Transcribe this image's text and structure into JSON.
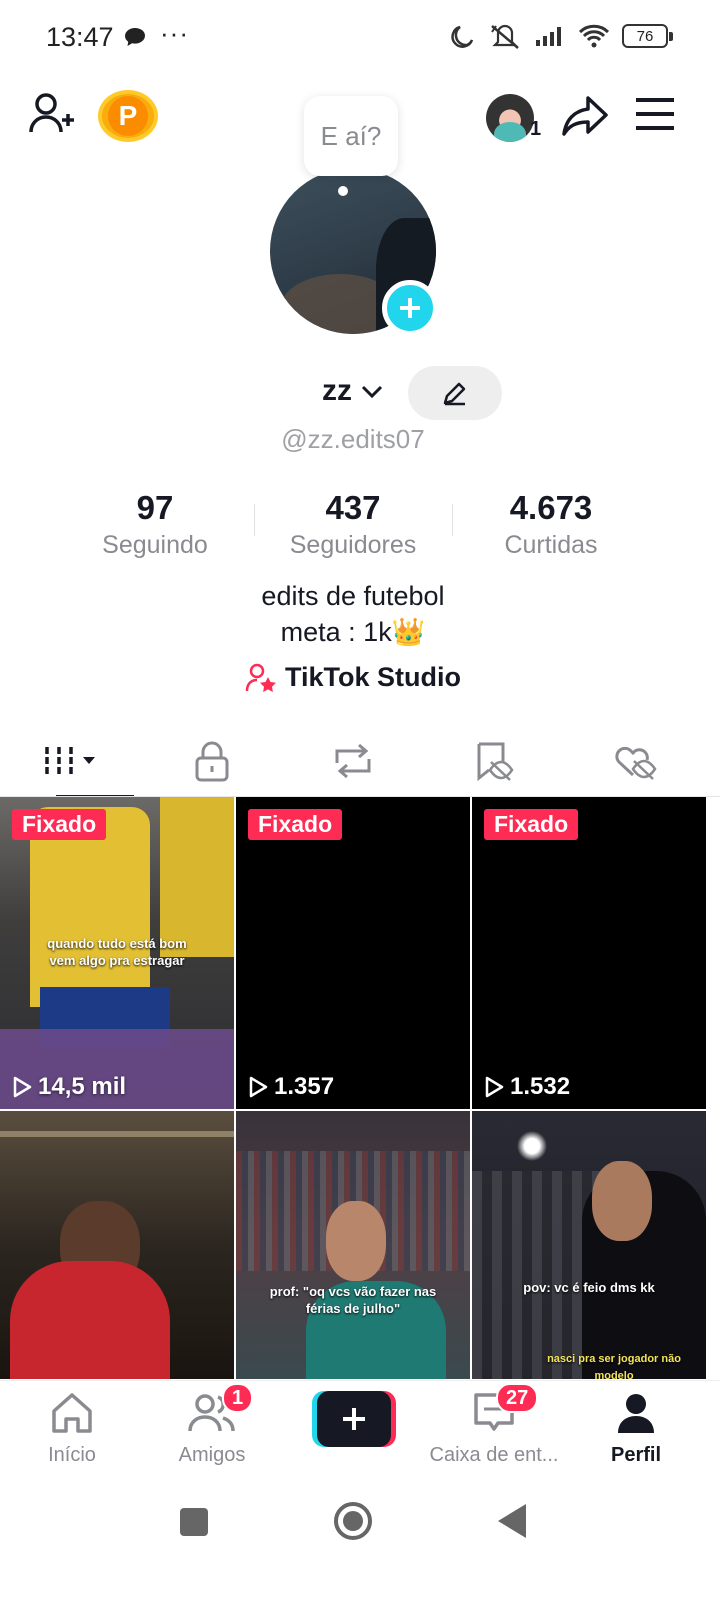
{
  "status_bar": {
    "time": "13:47",
    "more": "···",
    "battery": "76"
  },
  "header": {
    "avatar_count": "1",
    "coin_letter": "P"
  },
  "profile": {
    "bubble_text": "E aí?",
    "username": "zz",
    "handle": "@zz.edits07",
    "stats": [
      {
        "value": "97",
        "label": "Seguindo"
      },
      {
        "value": "437",
        "label": "Seguidores"
      },
      {
        "value": "4.673",
        "label": "Curtidas"
      }
    ],
    "bio_lines": [
      "edits de futebol",
      "meta : 1k👑"
    ],
    "studio_label": "TikTok Studio"
  },
  "tabs": [
    "videos",
    "private",
    "reposts",
    "favorites",
    "liked"
  ],
  "videos": [
    {
      "pinned": "Fixado",
      "views": "14,5 mil",
      "caption": "quando tudo está bom\nvem algo pra estragar"
    },
    {
      "pinned": "Fixado",
      "views": "1.357",
      "caption": ""
    },
    {
      "pinned": "Fixado",
      "views": "1.532",
      "caption": ""
    },
    {
      "pinned": "",
      "views": "",
      "caption": ""
    },
    {
      "pinned": "",
      "views": "",
      "caption": "prof: \"oq vcs vão fazer nas\nférias de julho\""
    },
    {
      "pinned": "",
      "views": "",
      "caption": "pov: vc é feio dms kk",
      "caption2": "nasci pra ser jogador não\nmodelo"
    }
  ],
  "bottom_nav": {
    "home": "Início",
    "friends": "Amigos",
    "friends_badge": "1",
    "inbox": "Caixa de ent...",
    "inbox_badge": "27",
    "profile": "Perfil"
  },
  "colors": {
    "accent_red": "#fe2c55",
    "accent_cyan": "#20d5ec",
    "text_primary": "#161823",
    "text_secondary": "#8a8b91"
  }
}
